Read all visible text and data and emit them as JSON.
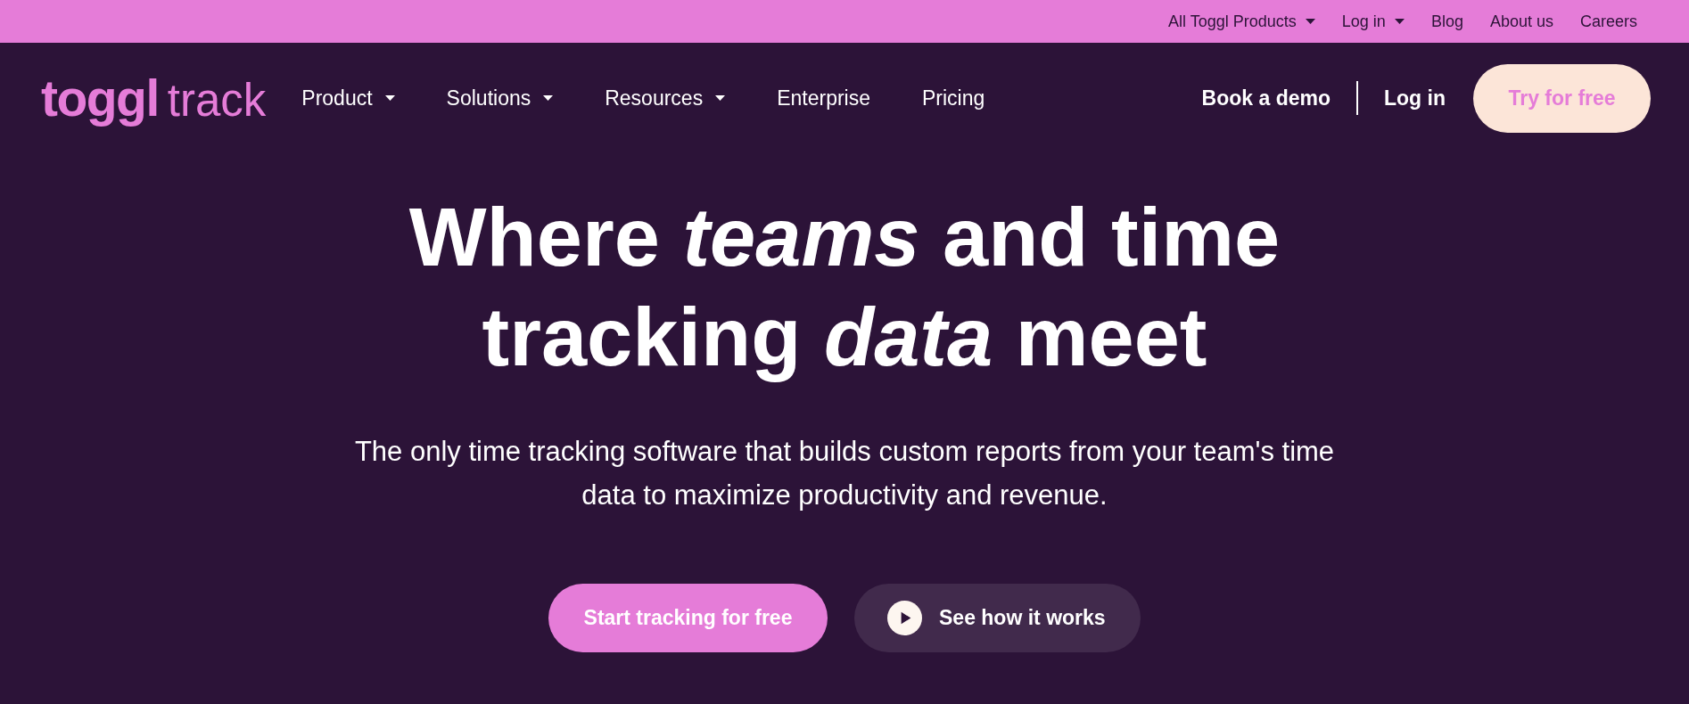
{
  "top_bar": {
    "links": [
      {
        "label": "All Toggl Products",
        "dropdown": true
      },
      {
        "label": "Log in",
        "dropdown": true
      },
      {
        "label": "Blog",
        "dropdown": false
      },
      {
        "label": "About us",
        "dropdown": false
      },
      {
        "label": "Careers",
        "dropdown": false
      }
    ]
  },
  "nav": {
    "logo": {
      "brand": "toggl",
      "product": "track"
    },
    "links": [
      {
        "label": "Product",
        "dropdown": true
      },
      {
        "label": "Solutions",
        "dropdown": true
      },
      {
        "label": "Resources",
        "dropdown": true
      },
      {
        "label": "Enterprise",
        "dropdown": false
      },
      {
        "label": "Pricing",
        "dropdown": false
      }
    ],
    "book_demo": "Book a demo",
    "login": "Log in",
    "cta": "Try for free"
  },
  "hero": {
    "headline": "Where *teams* and time tracking *data* meet",
    "subtitle": "The only time tracking software that builds custom reports from your team's time data to maximize productivity and revenue.",
    "buttons": [
      {
        "kind": "primary",
        "label": "Start tracking for free"
      },
      {
        "kind": "video",
        "label": "See how it works"
      }
    ]
  }
}
